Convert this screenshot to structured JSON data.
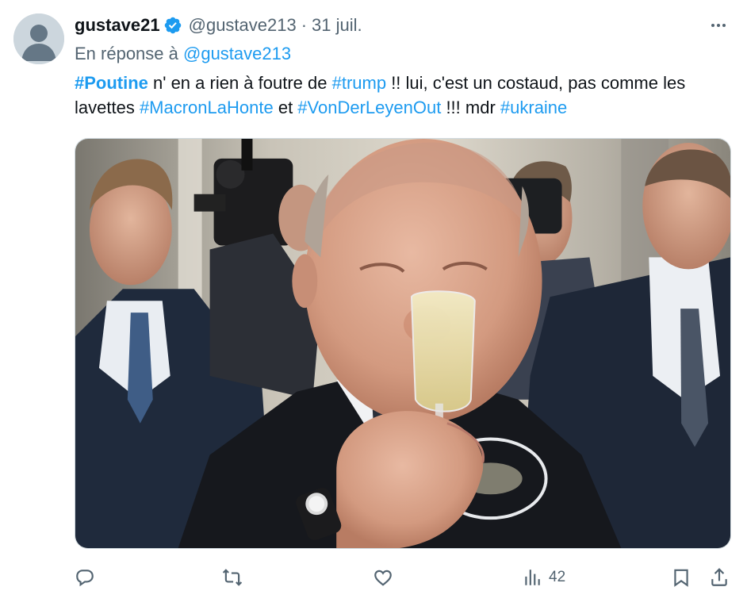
{
  "tweet": {
    "user": {
      "display_name": "gustave21",
      "handle": "@gustave213",
      "verified": true,
      "avatar_icon": "default-avatar-icon"
    },
    "separator": "·",
    "date": "31 juil.",
    "reply_to": {
      "prefix": "En réponse à",
      "handle": "@gustave213"
    },
    "text_parts": [
      {
        "text": "#Poutine",
        "style": "hashtag-bold"
      },
      {
        "text": " n' en a rien à foutre de ",
        "style": "plain"
      },
      {
        "text": "#trump",
        "style": "hashtag"
      },
      {
        "text": " !! lui, c'est un costaud, pas comme les lavettes ",
        "style": "plain"
      },
      {
        "text": "#MacronLaHonte",
        "style": "hashtag"
      },
      {
        "text": " et ",
        "style": "plain"
      },
      {
        "text": "#VonDerLeyenOut",
        "style": "hashtag"
      },
      {
        "text": " !!! mdr ",
        "style": "plain"
      },
      {
        "text": "#ukraine",
        "style": "hashtag"
      }
    ],
    "media": {
      "kind": "photo",
      "subject": "man in dark suit drinking champagne from a glass, security guards and cameraman in background"
    },
    "actions": {
      "reply_icon": "reply-icon",
      "retweet_icon": "retweet-icon",
      "like_icon": "like-icon",
      "views_icon": "views-icon",
      "views_count": "42",
      "bookmark_icon": "bookmark-icon",
      "share_icon": "share-icon",
      "more_icon": "more-icon"
    },
    "colors": {
      "accent": "#1d9bf0",
      "muted": "#536471",
      "text": "#0f1419",
      "verified": "#1d9bf0"
    }
  }
}
